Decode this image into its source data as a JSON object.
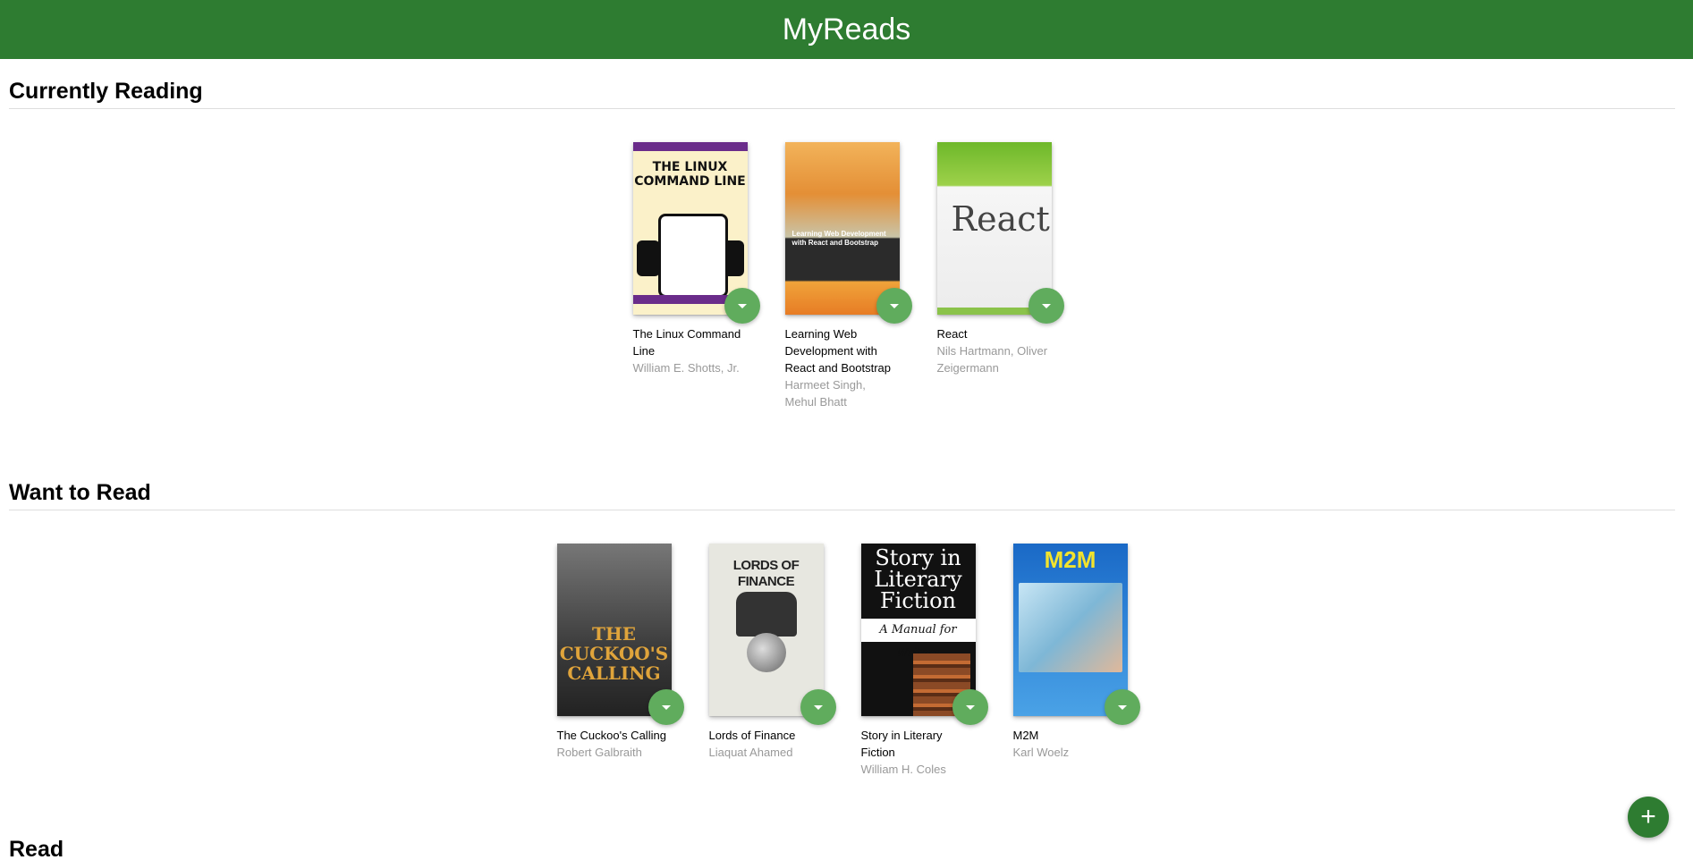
{
  "header": {
    "title": "MyReads"
  },
  "shelves": [
    {
      "title": "Currently Reading",
      "books": [
        {
          "title": "The Linux Command Line",
          "authors": "William E. Shotts, Jr.",
          "cover_text": "THE LINUX COMMAND LINE"
        },
        {
          "title": "Learning Web Development with React and Bootstrap",
          "authors": "Harmeet Singh, Mehul Bhatt",
          "cover_text": "Learning Web Development with React and Bootstrap"
        },
        {
          "title": "React",
          "authors": "Nils Hartmann, Oliver Zeigermann",
          "cover_text": "React"
        }
      ]
    },
    {
      "title": "Want to Read",
      "books": [
        {
          "title": "The Cuckoo's Calling",
          "authors": "Robert Galbraith",
          "cover_text": "THE CUCKOO'S CALLING"
        },
        {
          "title": "Lords of Finance",
          "authors": "Liaquat Ahamed",
          "cover_text": "LORDS OF FINANCE"
        },
        {
          "title": "Story in Literary Fiction",
          "authors": "William H. Coles",
          "cover_text": "Story in Literary Fiction",
          "cover_subtitle": "A Manual for Writers"
        },
        {
          "title": "M2M",
          "authors": "Karl Woelz",
          "cover_text": "M2M"
        }
      ]
    },
    {
      "title": "Read",
      "books": []
    }
  ],
  "add_button": {
    "label": "+"
  },
  "colors": {
    "header_bg": "#2e7c31",
    "changer_bg": "#60ac5d",
    "author_text": "#999999"
  }
}
